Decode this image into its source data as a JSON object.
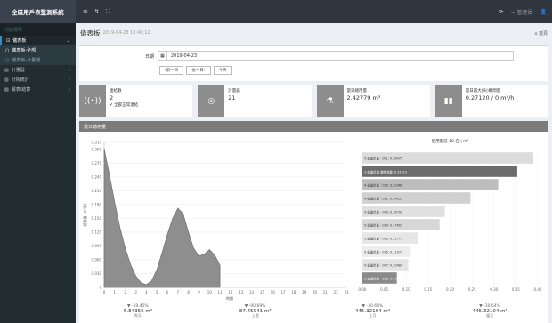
{
  "app": {
    "brand": "全區用戶表監測系統",
    "user": "= 管理員",
    "top_icons": [
      "≡",
      "↯",
      "⛶"
    ],
    "right_icons": [
      "⟳",
      "👤"
    ]
  },
  "sidebar": {
    "header": "功能選單",
    "items": [
      {
        "label": "儀表板",
        "icon": "chart-icon",
        "glyph": "⊡",
        "active": true,
        "expanded": true,
        "children": [
          {
            "label": "儀表板-全部",
            "selected": true
          },
          {
            "label": "儀表板-計量器",
            "selected": false
          }
        ]
      },
      {
        "label": "計量器",
        "icon": "meter-icon",
        "glyph": "▤"
      },
      {
        "label": "分析統計",
        "icon": "stats-icon",
        "glyph": "▥"
      },
      {
        "label": "報表/結算",
        "icon": "report-icon",
        "glyph": "▧"
      }
    ]
  },
  "page": {
    "title": "儀表板",
    "subtitle": "2019-04-23 13:48:12",
    "breadcrumb": "⌂ 首頁"
  },
  "date_filter": {
    "label": "日期",
    "value": "2019-04-23",
    "buttons": [
      "‹前一日",
      "後一日›",
      "今天"
    ]
  },
  "cards": [
    {
      "label": "連結數",
      "value": "2",
      "note": "全部正常連結",
      "icon": "signal-icon",
      "glyph": "((•))"
    },
    {
      "label": "計量器",
      "value": "21",
      "note": "",
      "icon": "meter-icon",
      "glyph": "◎"
    },
    {
      "label": "當日總用量",
      "value": "2.42779 m³",
      "note": "",
      "icon": "flask-icon",
      "glyph": "⚗"
    },
    {
      "label": "當日最大(尖)瞬間量",
      "value": "0.27120 / 0 m³/h",
      "note": "",
      "icon": "bar-chart-icon",
      "glyph": "▮▮"
    }
  ],
  "chart_section": {
    "title": "當日總用量"
  },
  "chart_data": [
    {
      "type": "area",
      "ylabel": "總用量 (m³/h)",
      "xlabel": "時間",
      "x": [
        0,
        0.5,
        1,
        1.5,
        2,
        2.5,
        3,
        3.5,
        4,
        4.5,
        5,
        5.5,
        6,
        6.5,
        7,
        7.5,
        8,
        8.5,
        9,
        9.5,
        10,
        10.5,
        11
      ],
      "values": [
        0.301,
        0.245,
        0.185,
        0.13,
        0.085,
        0.05,
        0.025,
        0.01,
        0.006,
        0.014,
        0.038,
        0.075,
        0.115,
        0.15,
        0.172,
        0.16,
        0.12,
        0.085,
        0.068,
        0.072,
        0.082,
        0.07,
        0.048
      ],
      "xlim": [
        0,
        23
      ],
      "xticks": [
        0,
        1,
        2,
        3,
        4,
        5,
        6,
        7,
        8,
        9,
        10,
        11,
        12,
        13,
        14,
        15,
        16,
        17,
        18,
        19,
        20,
        21,
        22,
        23
      ],
      "ylim": [
        0,
        0.315
      ],
      "yticks": [
        0,
        0.03,
        0.06,
        0.09,
        0.12,
        0.15,
        0.18,
        0.21,
        0.24,
        0.27,
        0.3,
        0.315
      ],
      "ytick_labels": [
        "0",
        "0.030",
        "0.060",
        "0.090",
        "0.120",
        "0.150",
        "0.180",
        "0.210",
        "0.240",
        "0.270",
        "0.300",
        "0.315"
      ],
      "grid": true
    },
    {
      "type": "bar",
      "title": "使用量前 10 名 | m³",
      "orientation": "horizontal",
      "categories": [
        "5-重量計量 - 001: 0.38975",
        "2-重量計量-儲存池量: 0.35310",
        "4-重量計量 - 010: 0.30988",
        "4-重量計量 - 011: 0.24655",
        "5-重量計量 - 004: 0.18792",
        "5-重量計量 - 019: 0.17603",
        "5-重量計量 - 003: 0.12771",
        "5-重量計量 - 015: 0.11072",
        "5-重量計量 - 007: 0.10484",
        "3-重量計量 - 012: 0.07859"
      ],
      "values": [
        0.38975,
        0.3531,
        0.30988,
        0.24655,
        0.18792,
        0.17603,
        0.12771,
        0.11072,
        0.10484,
        0.07859
      ],
      "xlim": [
        0,
        0.4
      ],
      "xticks": [
        0,
        0.05,
        0.1,
        0.15,
        0.2,
        0.25,
        0.3,
        0.35,
        0.4
      ],
      "xtick_labels": [
        "0.00",
        "0.05",
        "0.10",
        "0.15",
        "0.20",
        "0.25",
        "0.30",
        "0.35",
        "0.40"
      ],
      "colors": [
        "#dcdcdc",
        "#6c6c6c",
        "#bdbdbd",
        "#d0d0d0",
        "#e0e0e0",
        "#d7d7d7",
        "#e6e6e6",
        "#ededed",
        "#e4e4e4",
        "#8a8a8a"
      ]
    }
  ],
  "stats": [
    {
      "pct": "▼ -59.45%",
      "value": "5.84356 m³",
      "caption": "昨天"
    },
    {
      "pct": "▼ -90.69%",
      "value": "87.45941 m³",
      "caption": "上週"
    },
    {
      "pct": "▼ -30.64%",
      "value": "445.32104 m³",
      "caption": "上月"
    },
    {
      "pct": "▼ -30.64%",
      "value": "445.32104 m³",
      "caption": "當月"
    }
  ]
}
